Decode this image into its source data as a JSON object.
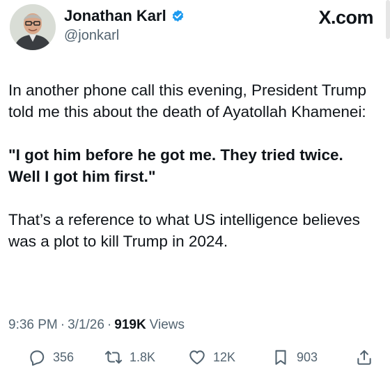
{
  "author": {
    "name": "Jonathan Karl",
    "handle": "@jonkarl",
    "verified": true,
    "avatar_icon": "person-avatar-icon"
  },
  "brand": {
    "label": "X.com"
  },
  "tweet": {
    "paragraph_1": "In another phone call this evening, President Trump told me this about the death of Ayatollah Khamenei:",
    "quote": "\"I got him before he got me. They tried twice. Well I got him first.\"",
    "paragraph_3": "That’s a reference to what US intelligence believes was a plot to kill Trump in 2024."
  },
  "meta": {
    "time": "9:36 PM",
    "date": "3/1/26",
    "views_count": "919K",
    "views_label": "Views"
  },
  "actions": {
    "replies": "356",
    "reposts": "1.8K",
    "likes": "12K",
    "bookmarks": "903"
  },
  "colors": {
    "text": "#0f1419",
    "secondary": "#536471",
    "verified_blue": "#1d9bf0"
  }
}
